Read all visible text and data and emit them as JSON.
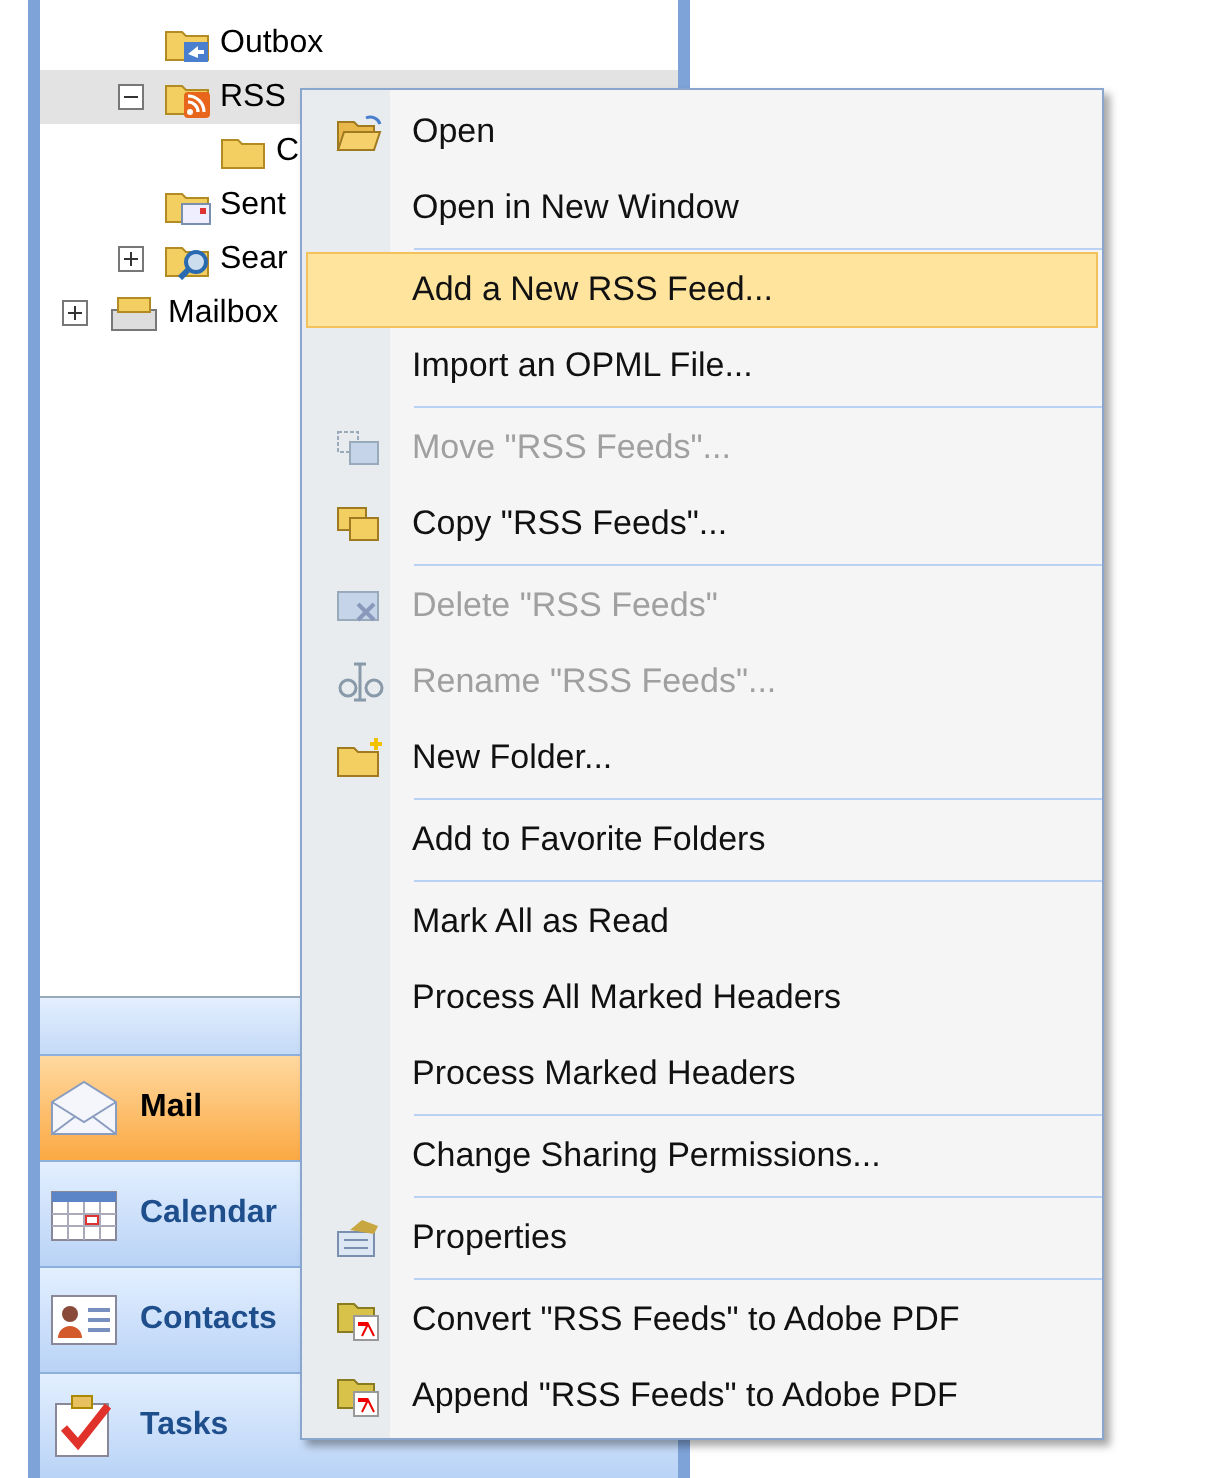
{
  "tree": {
    "items": [
      {
        "children": [
          {
            "label": "Outbox",
            "selected": false
          },
          {
            "label": "RSS",
            "selected": true,
            "expanded": true,
            "children": [
              {
                "label": "C",
                "selected": false
              }
            ]
          },
          {
            "label": "Sent",
            "selected": false
          },
          {
            "label": "Sear",
            "selected": false,
            "expanded": false
          }
        ]
      },
      {
        "label": "Mailbox",
        "selected": false,
        "expanded": false
      }
    ]
  },
  "nav_buttons": [
    {
      "label": "Mail",
      "selected": true
    },
    {
      "label": "Calendar",
      "selected": false
    },
    {
      "label": "Contacts",
      "selected": false
    },
    {
      "label": "Tasks",
      "selected": false
    }
  ],
  "context_menu": {
    "items": [
      {
        "kind": "item",
        "label": "Open",
        "disabled": false,
        "selected": false
      },
      {
        "kind": "item",
        "label": "Open in New Window",
        "disabled": false,
        "selected": false
      },
      {
        "kind": "separator"
      },
      {
        "kind": "item",
        "label": "Add a New RSS Feed...",
        "disabled": false,
        "selected": true
      },
      {
        "kind": "item",
        "label": "Import an OPML File...",
        "disabled": false,
        "selected": false
      },
      {
        "kind": "separator"
      },
      {
        "kind": "item",
        "label": "Move \"RSS Feeds\"...",
        "disabled": true,
        "selected": false
      },
      {
        "kind": "item",
        "label": "Copy \"RSS Feeds\"...",
        "disabled": false,
        "selected": false
      },
      {
        "kind": "separator"
      },
      {
        "kind": "item",
        "label": "Delete \"RSS Feeds\"",
        "disabled": true,
        "selected": false
      },
      {
        "kind": "item",
        "label": "Rename \"RSS Feeds\"...",
        "disabled": true,
        "selected": false
      },
      {
        "kind": "item",
        "label": "New Folder...",
        "disabled": false,
        "selected": false
      },
      {
        "kind": "separator"
      },
      {
        "kind": "item",
        "label": "Add to Favorite Folders",
        "disabled": false,
        "selected": false
      },
      {
        "kind": "separator"
      },
      {
        "kind": "item",
        "label": "Mark All as Read",
        "disabled": false,
        "selected": false
      },
      {
        "kind": "item",
        "label": "Process All Marked Headers",
        "disabled": false,
        "selected": false
      },
      {
        "kind": "item",
        "label": "Process Marked Headers",
        "disabled": false,
        "selected": false
      },
      {
        "kind": "separator"
      },
      {
        "kind": "item",
        "label": "Change Sharing Permissions...",
        "disabled": false,
        "selected": false
      },
      {
        "kind": "separator"
      },
      {
        "kind": "item",
        "label": "Properties",
        "disabled": false,
        "selected": false
      },
      {
        "kind": "separator"
      },
      {
        "kind": "item",
        "label": "Convert \"RSS Feeds\" to Adobe PDF",
        "disabled": false,
        "selected": false
      },
      {
        "kind": "item",
        "label": "Append \"RSS Feeds\" to Adobe PDF",
        "disabled": false,
        "selected": false
      }
    ]
  }
}
